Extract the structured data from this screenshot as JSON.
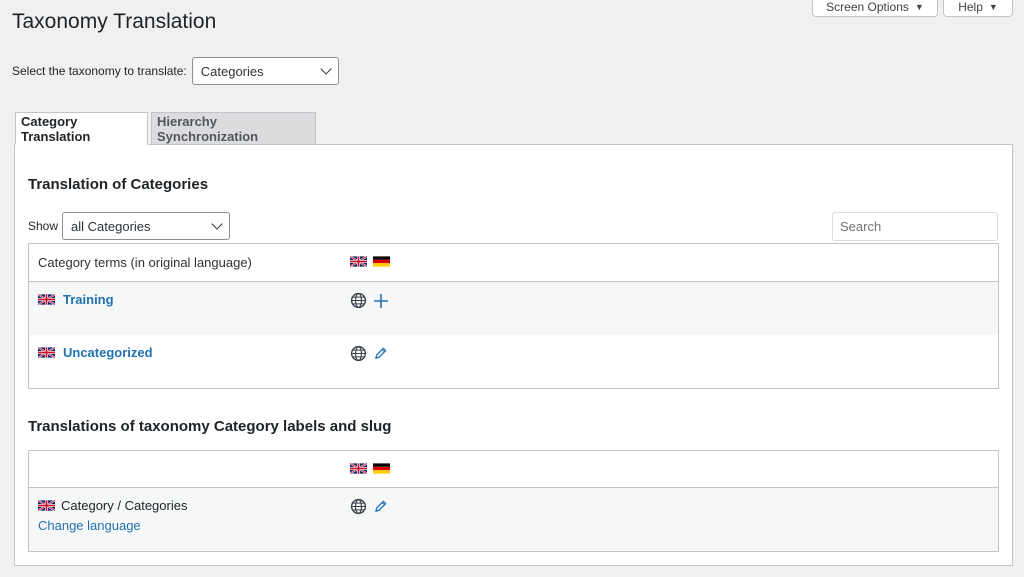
{
  "page": {
    "title": "Taxonomy Translation",
    "screen_options_label": "Screen Options",
    "help_label": "Help"
  },
  "taxonomy_select": {
    "label": "Select the taxonomy to translate:",
    "selected": "Categories"
  },
  "tabs": [
    {
      "label": "Category Translation",
      "active": true
    },
    {
      "label": "Hierarchy Synchronization",
      "active": false
    }
  ],
  "terms_section": {
    "title": "Translation of Categories",
    "show_label": "Show",
    "show_selected": "all Categories",
    "search_placeholder": "Search",
    "header": "Category terms (in original language)",
    "languages": [
      "english-flag-icon",
      "german-flag-icon"
    ],
    "rows": [
      {
        "name": "Training",
        "action": "plus-icon"
      },
      {
        "name": "Uncategorized",
        "action": "pencil-icon"
      }
    ]
  },
  "labels_section": {
    "title": "Translations of taxonomy Category labels and slug",
    "row_label": "Category / Categories",
    "change_language": "Change language"
  },
  "colors": {
    "link": "#2271b1",
    "background": "#f0f0f1",
    "panel": "#ffffff"
  }
}
